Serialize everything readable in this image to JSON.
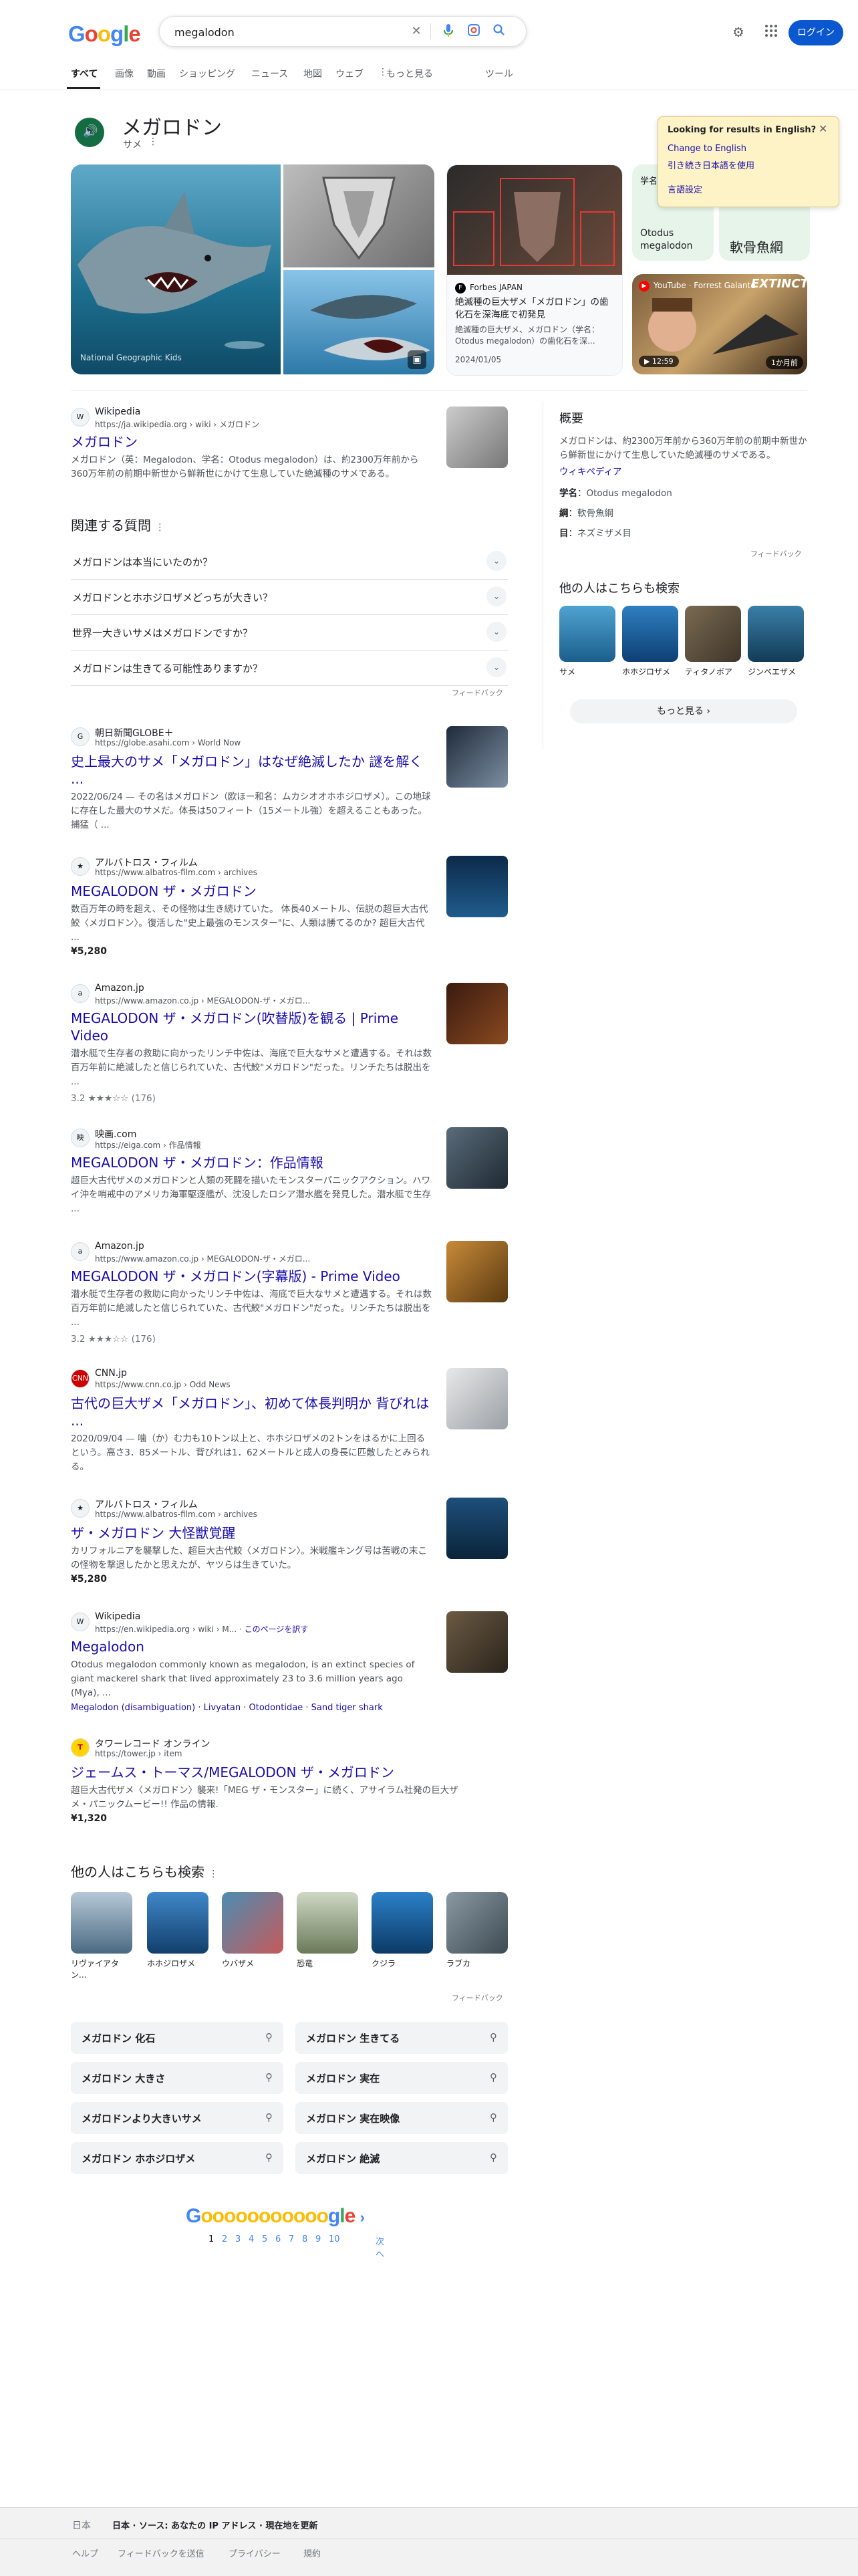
{
  "header": {
    "search_value": "megalodon",
    "login": "ログイン",
    "tabs": [
      "すべて",
      "画像",
      "動画",
      "ショッピング",
      "ニュース",
      "地図",
      "ウェブ",
      "もっと見る",
      "ツール"
    ]
  },
  "entity": {
    "title": "メガロドン",
    "subtitle": "サメ",
    "image_credit": "National Geographic Kids",
    "news_source": "Forbes JAPAN",
    "news_title": "絶滅種の巨大ザメ「メガロドン」の歯化石を深海底で初発見",
    "news_snippet": "絶滅種の巨大ザメ、メガロドン（学名：Otodus megalodon）の歯化石を深...",
    "news_date": "2024/01/05",
    "chips": [
      {
        "label": "学名",
        "value": "Otodus megalodon"
      },
      {
        "label": "",
        "value": "軟骨魚綱"
      }
    ],
    "video_source": "YouTube · Forrest Galante",
    "video_duration": "12:59",
    "video_age": "1か月前",
    "video_text": "EXTINCT?"
  },
  "lang_popup": {
    "title": "Looking for results in English?",
    "change": "Change to English",
    "keep": "引き続き日本語を使用",
    "settings": "言語設定"
  },
  "overview": {
    "heading": "概要",
    "text": "メガロドンは、約2300万年前から360万年前の前期中新世から鮮新世にかけて生息していた絶滅種のサメである。",
    "source": "ウィキペディア",
    "facts": [
      {
        "label": "学名",
        "value": "Otodus megalodon"
      },
      {
        "label": "綱",
        "value": "軟骨魚綱"
      },
      {
        "label": "目",
        "value": "ネズミザメ目"
      }
    ],
    "feedback": "フィードバック",
    "others_heading": "他の人はこちらも検索",
    "others": [
      "サメ",
      "ホホジロザメ",
      "ティタノボア",
      "ジンベエザメ"
    ],
    "more": "もっと見る"
  },
  "wiki_top": {
    "site": "Wikipedia",
    "url": "https://ja.wikipedia.org › wiki › メガロドン",
    "title": "メガロドン",
    "snippet": "メガロドン（英：Megalodon、学名：Otodus megalodon）は、約2300万年前から360万年前の前期中新世から鮮新世にかけて生息していた絶滅種のサメである。"
  },
  "paa": {
    "heading": "関連する質問",
    "questions": [
      "メガロドンは本当にいたのか？",
      "メガロドンとホホジロザメどっちが大きい？",
      "世界一大きいサメはメガロドンですか？",
      "メガロドンは生きてる可能性ありますか？"
    ],
    "feedback": "フィードバック"
  },
  "results": [
    {
      "site": "朝日新聞GLOBE＋",
      "url": "https://globe.asahi.com › World Now",
      "title": "史上最大のサメ「メガロドン」はなぜ絶滅したか 謎を解く ...",
      "snippet": "2022/06/24 — その名はメガロドン（欧ほー和名：ムカシオオホホジロザメ）。この地球に存在した最大のサメだ。体長は50フィート（15メートル強）を超えることもあった。捕猛（ ...",
      "price": "",
      "rating": ""
    },
    {
      "site": "アルバトロス・フィルム",
      "url": "https://www.albatros-film.com › archives",
      "title": "MEGALODON ザ・メガロドン",
      "snippet": "数百万年の時を超え、その怪物は生き続けていた。 体長40メートル、伝説の超巨大古代鮫〈メガロドン〉。復活した\"史上最強のモンスター\"に、人類は勝てるのか? 超巨大古代 ...",
      "price": "¥5,280",
      "rating": ""
    },
    {
      "site": "Amazon.jp",
      "url": "https://www.amazon.co.jp › MEGALODON-ザ・メガロ...",
      "title": "MEGALODON ザ・メガロドン(吹替版)を観る | Prime Video",
      "snippet": "潜水艇で生存者の救助に向かったリンチ中佐は、海底で巨大なサメと遭遇する。それは数百万年前に絶滅したと信じられていた、古代鮫\"メガロドン\"だった。リンチたちは脱出を ...",
      "price": "",
      "rating": "3.2 ★★★☆☆ (176)"
    },
    {
      "site": "映画.com",
      "url": "https://eiga.com › 作品情報",
      "title": "MEGALODON ザ・メガロドン：作品情報",
      "snippet": "超巨大古代ザメのメガロドンと人類の死闘を描いたモンスターパニックアクション。ハワイ沖を哨戒中のアメリカ海軍駆逐艦が、沈没したロシア潜水艦を発見した。潜水艇で生存 ...",
      "price": "",
      "rating": ""
    },
    {
      "site": "Amazon.jp",
      "url": "https://www.amazon.co.jp › MEGALODON-ザ・メガロ...",
      "title": "MEGALODON ザ・メガロドン(字幕版) - Prime Video",
      "snippet": "潜水艇で生存者の救助に向かったリンチ中佐は、海底で巨大なサメと遭遇する。それは数百万年前に絶滅したと信じられていた、古代鮫\"メガロドン\"だった。リンチたちは脱出を ...",
      "price": "",
      "rating": "3.2 ★★★☆☆ (176)"
    },
    {
      "site": "CNN.jp",
      "url": "https://www.cnn.co.jp › Odd News",
      "title": "古代の巨大ザメ「メガロドン」、初めて体長判明か 背びれは ...",
      "snippet": "2020/09/04 — 噛（か）む力も10トン以上と、ホホジロザメの2トンをはるかに上回るという。高さ3．85メートル、背びれは1．62メートルと成人の身長に匹敵したとみられる。",
      "price": "",
      "rating": ""
    },
    {
      "site": "アルバトロス・フィルム",
      "url": "https://www.albatros-film.com › archives",
      "title": "ザ・メガロドン 大怪獣覚醒",
      "snippet": "カリフォルニアを襲撃した、超巨大古代鮫〈メガロドン〉。米戦艦キング号は苦戦の末この怪物を撃退したかと思えたが、ヤツらは生きていた。",
      "price": "¥5,280",
      "rating": ""
    }
  ],
  "wiki_en": {
    "site": "Wikipedia",
    "url": "https://en.wikipedia.org › wiki › M...",
    "translate": "このページを訳す",
    "title": "Megalodon",
    "snippet": "Otodus megalodon commonly known as megalodon, is an extinct species of giant mackerel shark that lived approximately 23 to 3.6 million years ago (Mya), ...",
    "links": [
      "Megalodon (disambiguation)",
      "Livyatan",
      "Otodontidae",
      "Sand tiger shark"
    ]
  },
  "tower": {
    "site": "タワーレコード オンライン",
    "url": "https://tower.jp › item",
    "title": "ジェームス・トーマス/MEGALODON ザ・メガロドン",
    "snippet": "超巨大古代ザメ〈メガロドン〉襲来!「MEG ザ・モンスター」に続く、アサイラム社発の巨大ザメ・パニックムービー!! 作品の情報.",
    "price": "¥1,320"
  },
  "also_search": {
    "heading": "他の人はこちらも検索",
    "items": [
      "リヴァイアタン...",
      "ホホジロザメ",
      "ウバザメ",
      "恐竜",
      "クジラ",
      "ラブカ"
    ],
    "feedback": "フィードバック"
  },
  "related_searches": [
    "メガロドン 化石",
    "メガロドン 生きてる",
    "メガロドン 大きさ",
    "メガロドン 実在",
    "メガロドンより大きいサメ",
    "メガロドン 実在映像",
    "メガロドン ホホジロザメ",
    "メガロドン 絶滅"
  ],
  "pagination": {
    "pages": [
      "1",
      "2",
      "3",
      "4",
      "5",
      "6",
      "7",
      "8",
      "9",
      "10"
    ],
    "next": "次へ"
  },
  "footer": {
    "country": "日本",
    "location": "日本 · ソース: あなたの IP アドレス · 現在地を更新",
    "links": [
      "ヘルプ",
      "フィードバックを送信",
      "プライバシー",
      "規約"
    ]
  }
}
